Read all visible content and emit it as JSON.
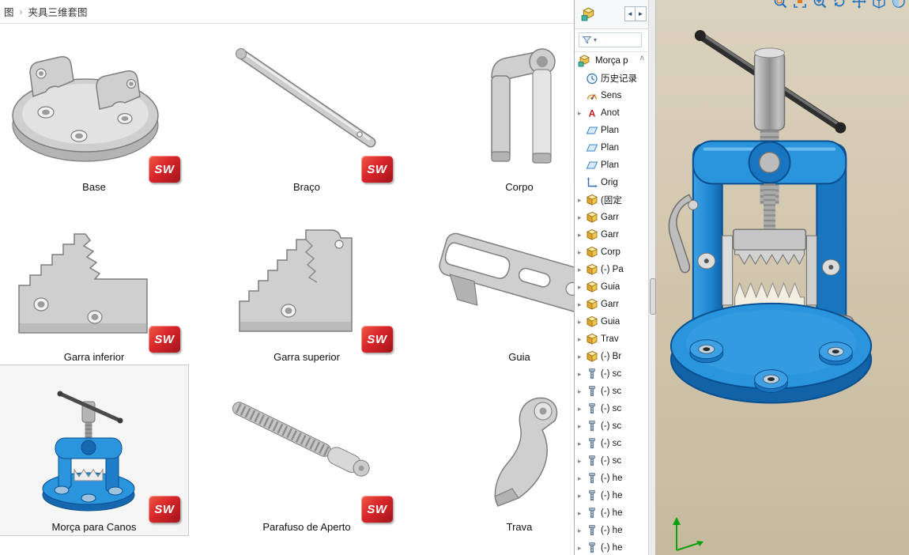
{
  "breadcrumb": {
    "root": "图",
    "separator": "›",
    "title": "夹具三维套图"
  },
  "gallery": {
    "badge_text": "SW",
    "items": [
      {
        "label": "Base",
        "selected": false
      },
      {
        "label": "Braço",
        "selected": false
      },
      {
        "label": "Corpo",
        "selected": false
      },
      {
        "label": "Garra inferior",
        "selected": false
      },
      {
        "label": "Garra superior",
        "selected": false
      },
      {
        "label": "Guia",
        "selected": false
      },
      {
        "label": "Morça para Canos",
        "selected": true
      },
      {
        "label": "Parafuso de Aperto",
        "selected": false
      },
      {
        "label": "Trava",
        "selected": false
      }
    ]
  },
  "solidworks": {
    "panel_nav": {
      "back": "◄",
      "forward": "►"
    },
    "filter": {
      "dropdown": "▾"
    },
    "tree": {
      "root": "Morça p",
      "scroll_up": "∧",
      "items": [
        {
          "label": "历史记录",
          "icon": "history",
          "arrow": false
        },
        {
          "label": "Sens",
          "icon": "sensor",
          "arrow": false
        },
        {
          "label": "Anot",
          "icon": "annotation",
          "arrow": true
        },
        {
          "label": "Plan",
          "icon": "plane",
          "arrow": false
        },
        {
          "label": "Plan",
          "icon": "plane",
          "arrow": false
        },
        {
          "label": "Plan",
          "icon": "plane",
          "arrow": false
        },
        {
          "label": "Orig",
          "icon": "origin",
          "arrow": false
        },
        {
          "label": "(固定",
          "icon": "part",
          "arrow": true
        },
        {
          "label": "Garr",
          "icon": "part",
          "arrow": true
        },
        {
          "label": "Garr",
          "icon": "part",
          "arrow": true
        },
        {
          "label": "Corp",
          "icon": "part",
          "arrow": true
        },
        {
          "label": "(-) Pa",
          "icon": "part",
          "arrow": true
        },
        {
          "label": "Guia",
          "icon": "part",
          "arrow": true
        },
        {
          "label": "Garr",
          "icon": "part",
          "arrow": true
        },
        {
          "label": "Guia",
          "icon": "part",
          "arrow": true
        },
        {
          "label": "Trav",
          "icon": "part",
          "arrow": true
        },
        {
          "label": "(-) Br",
          "icon": "part",
          "arrow": true
        },
        {
          "label": "(-) sc",
          "icon": "screw",
          "arrow": true
        },
        {
          "label": "(-) sc",
          "icon": "screw",
          "arrow": true
        },
        {
          "label": "(-) sc",
          "icon": "screw",
          "arrow": true
        },
        {
          "label": "(-) sc",
          "icon": "screw",
          "arrow": true
        },
        {
          "label": "(-) sc",
          "icon": "screw",
          "arrow": true
        },
        {
          "label": "(-) sc",
          "icon": "screw",
          "arrow": true
        },
        {
          "label": "(-) he",
          "icon": "screw",
          "arrow": true
        },
        {
          "label": "(-) he",
          "icon": "screw",
          "arrow": true
        },
        {
          "label": "(-) he",
          "icon": "screw",
          "arrow": true
        },
        {
          "label": "(-) he",
          "icon": "screw",
          "arrow": true
        },
        {
          "label": "(-) he",
          "icon": "screw",
          "arrow": true
        }
      ]
    },
    "viewport_toolbar_icons": [
      "zoom-area",
      "zoom-fit",
      "zoom-in",
      "rotate-view",
      "pan",
      "view-orientation",
      "display-style"
    ]
  }
}
